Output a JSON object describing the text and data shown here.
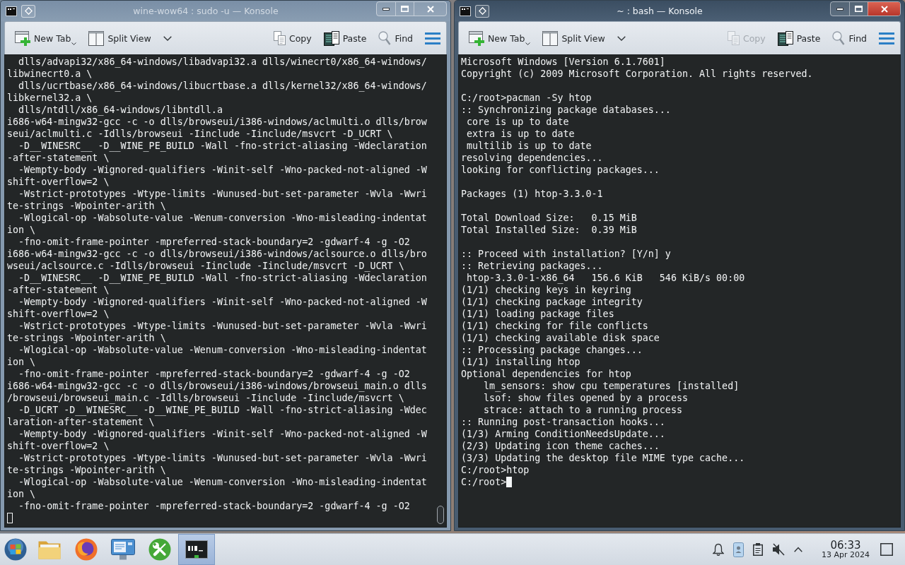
{
  "windows": [
    {
      "title": "wine-wow64 : sudo -u — Konsole",
      "active": false,
      "toolbar": {
        "left": [
          {
            "kind": "new-tab",
            "label": "New Tab",
            "disabled": false
          },
          {
            "kind": "split-view",
            "label": "Split View",
            "disabled": false
          },
          {
            "kind": "dropdown",
            "disabled": false
          }
        ],
        "right": [
          {
            "kind": "copy",
            "label": "Copy",
            "disabled": false
          },
          {
            "kind": "paste",
            "label": "Paste",
            "disabled": false
          },
          {
            "kind": "find",
            "label": "Find",
            "disabled": false
          },
          {
            "kind": "menu",
            "disabled": false
          }
        ]
      },
      "terminal": {
        "blocks": [
          [
            "  dlls/advapi32/x86_64-windows/libadvapi32.a dlls/winecrt0/x86_64-windows/",
            "libwinecrt0.a \\",
            "  dlls/ucrtbase/x86_64-windows/libucrtbase.a dlls/kernel32/x86_64-windows/",
            "libkernel32.a \\",
            "  dlls/ntdll/x86_64-windows/libntdll.a",
            "i686-w64-mingw32-gcc -c -o dlls/browseui/i386-windows/aclmulti.o dlls/brow",
            "seui/aclmulti.c -Idlls/browseui -Iinclude -Iinclude/msvcrt -D_UCRT \\",
            "  -D__WINESRC__ -D__WINE_PE_BUILD -Wall -fno-strict-aliasing -Wdeclaration",
            "-after-statement \\",
            "  -Wempty-body -Wignored-qualifiers -Winit-self -Wno-packed-not-aligned -W",
            "shift-overflow=2 \\",
            "  -Wstrict-prototypes -Wtype-limits -Wunused-but-set-parameter -Wvla -Wwri",
            "te-strings -Wpointer-arith \\",
            "  -Wlogical-op -Wabsolute-value -Wenum-conversion -Wno-misleading-indentat",
            "ion \\",
            "  -fno-omit-frame-pointer -mpreferred-stack-boundary=2 -gdwarf-4 -g -O2",
            "i686-w64-mingw32-gcc -c -o dlls/browseui/i386-windows/aclsource.o dlls/bro",
            "wseui/aclsource.c -Idlls/browseui -Iinclude -Iinclude/msvcrt -D_UCRT \\",
            "  -D__WINESRC__ -D__WINE_PE_BUILD -Wall -fno-strict-aliasing -Wdeclaration",
            "-after-statement \\",
            "  -Wempty-body -Wignored-qualifiers -Winit-self -Wno-packed-not-aligned -W",
            "shift-overflow=2 \\",
            "  -Wstrict-prototypes -Wtype-limits -Wunused-but-set-parameter -Wvla -Wwri",
            "te-strings -Wpointer-arith \\",
            "  -Wlogical-op -Wabsolute-value -Wenum-conversion -Wno-misleading-indentat",
            "ion \\",
            "  -fno-omit-frame-pointer -mpreferred-stack-boundary=2 -gdwarf-4 -g -O2",
            "i686-w64-mingw32-gcc -c -o dlls/browseui/i386-windows/browseui_main.o dlls",
            "/browseui/browseui_main.c -Idlls/browseui -Iinclude -Iinclude/msvcrt \\",
            "  -D_UCRT -D__WINESRC__ -D__WINE_PE_BUILD -Wall -fno-strict-aliasing -Wdec",
            "laration-after-statement \\",
            "  -Wempty-body -Wignored-qualifiers -Winit-self -Wno-packed-not-aligned -W",
            "shift-overflow=2 \\",
            "  -Wstrict-prototypes -Wtype-limits -Wunused-but-set-parameter -Wvla -Wwri",
            "te-strings -Wpointer-arith \\",
            "  -Wlogical-op -Wabsolute-value -Wenum-conversion -Wno-misleading-indentat",
            "ion \\",
            "  -fno-omit-frame-pointer -mpreferred-stack-boundary=2 -gdwarf-4 -g -O2"
          ]
        ]
      }
    },
    {
      "title": "~ : bash — Konsole",
      "active": true,
      "toolbar": {
        "left": [
          {
            "kind": "new-tab",
            "label": "New Tab",
            "disabled": false
          },
          {
            "kind": "split-view",
            "label": "Split View",
            "disabled": false
          },
          {
            "kind": "dropdown",
            "disabled": false
          }
        ],
        "right": [
          {
            "kind": "copy",
            "label": "Copy",
            "disabled": true
          },
          {
            "kind": "paste",
            "label": "Paste",
            "disabled": false
          },
          {
            "kind": "find",
            "label": "Find",
            "disabled": false
          },
          {
            "kind": "menu",
            "disabled": false
          }
        ]
      },
      "terminal": {
        "blocks": [
          [
            "Microsoft Windows [Version 6.1.7601]",
            "Copyright (c) 2009 Microsoft Corporation. All rights reserved."
          ],
          [
            "C:/root>pacman -Sy htop",
            ":: Synchronizing package databases...",
            " core is up to date",
            " extra is up to date",
            " multilib is up to date",
            "resolving dependencies...",
            "looking for conflicting packages..."
          ],
          [
            "Packages (1) htop-3.3.0-1"
          ],
          [
            "Total Download Size:   0.15 MiB",
            "Total Installed Size:  0.39 MiB"
          ],
          [
            ":: Proceed with installation? [Y/n] y",
            ":: Retrieving packages...",
            " htop-3.3.0-1-x86_64   156.6 KiB   546 KiB/s 00:00",
            "(1/1) checking keys in keyring",
            "(1/1) checking package integrity",
            "(1/1) loading package files",
            "(1/1) checking for file conflicts",
            "(1/1) checking available disk space",
            ":: Processing package changes...",
            "(1/1) installing htop",
            "Optional dependencies for htop",
            "    lm_sensors: show cpu temperatures [installed]",
            "    lsof: show files opened by a process",
            "    strace: attach to a running process",
            ":: Running post-transaction hooks...",
            "(1/3) Arming ConditionNeedsUpdate...",
            "(2/3) Updating icon theme caches...",
            "(3/3) Updating the desktop file MIME type cache...",
            "C:/root>htop"
          ]
        ],
        "prompt": "C:/root>"
      }
    }
  ],
  "taskbar": {
    "items": [
      {
        "kind": "start",
        "selected": false
      },
      {
        "kind": "folder",
        "selected": false
      },
      {
        "kind": "browser",
        "selected": false
      },
      {
        "kind": "monitor",
        "selected": false
      },
      {
        "kind": "tools",
        "selected": false
      },
      {
        "kind": "terminal",
        "selected": true
      }
    ],
    "tray": {
      "volume_muted": true
    },
    "clock": {
      "time": "06:33",
      "date": "13 Apr 2024"
    }
  }
}
